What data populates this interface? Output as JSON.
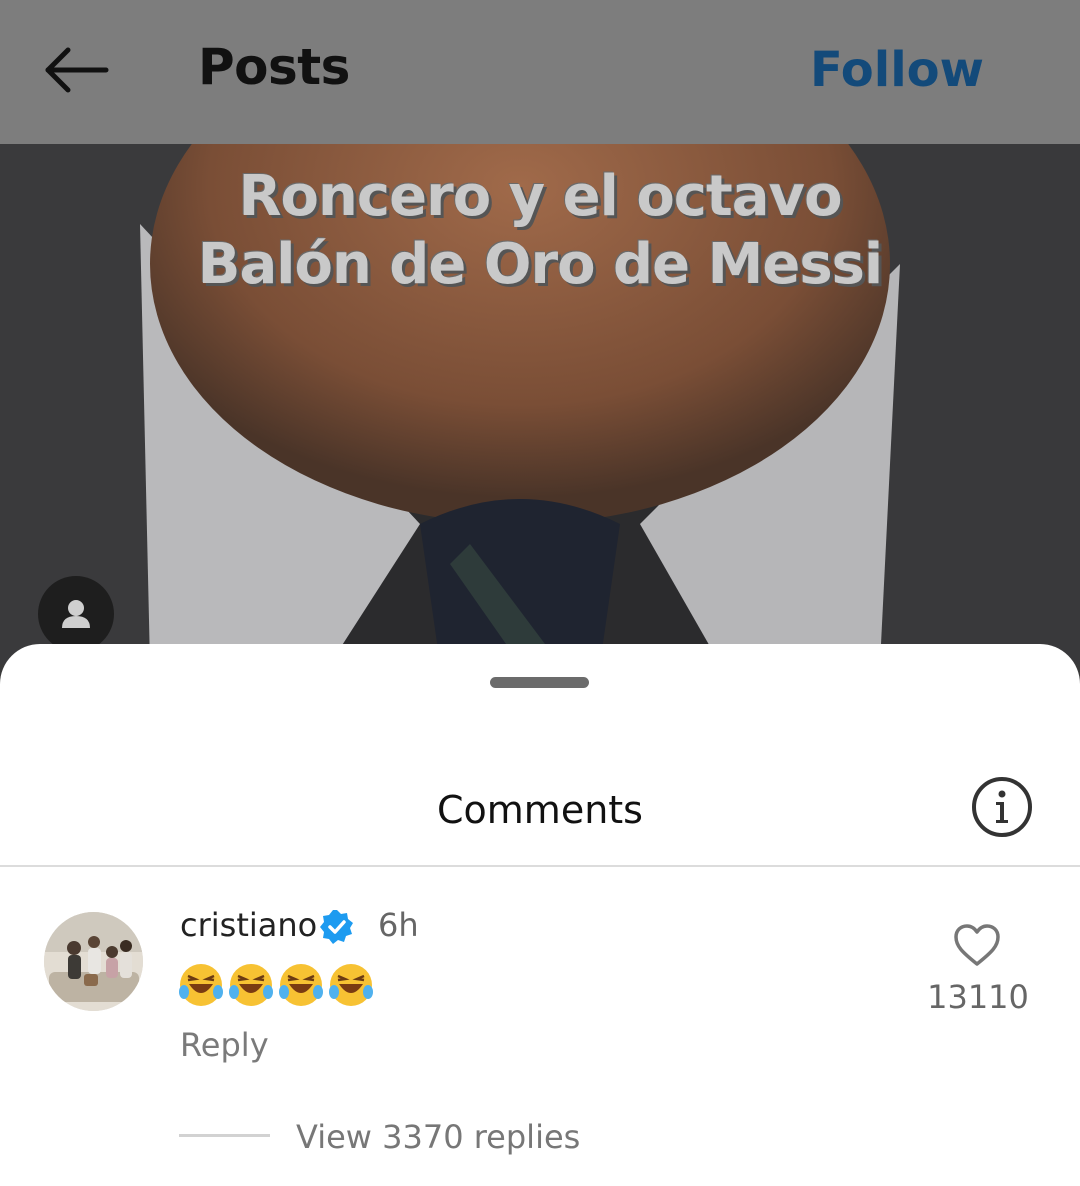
{
  "header": {
    "title": "Posts",
    "follow_label": "Follow",
    "back_icon": "arrow-left-icon"
  },
  "video": {
    "caption_line1": "Roncero y el octavo",
    "caption_line2": "Balón de Oro de Messi",
    "profile_icon": "person-icon"
  },
  "comments_sheet": {
    "title": "Comments",
    "info_icon": "info-icon",
    "comment": {
      "username": "cristiano",
      "verified": true,
      "time": "6h",
      "text": "😂😂😂😂",
      "reply_label": "Reply",
      "like_count": "13110",
      "view_replies": "View 3370 replies"
    }
  },
  "colors": {
    "header_bg": "#7d7d7d",
    "follow": "#134a7a",
    "verified_badge": "#1d9bf0"
  }
}
